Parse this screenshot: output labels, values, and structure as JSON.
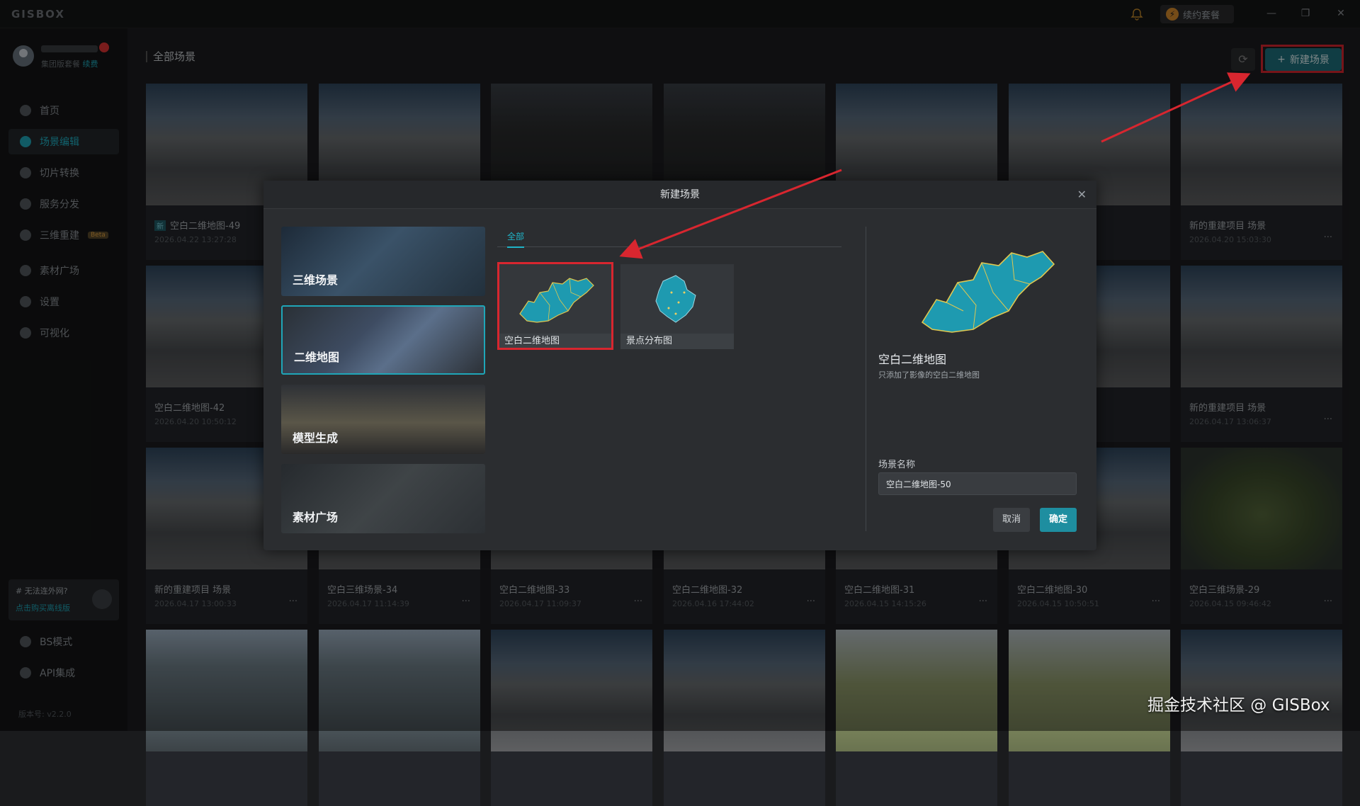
{
  "app": {
    "logo": "GISBOX",
    "renew_label": "续约套餐"
  },
  "user": {
    "tier": "集团版套餐",
    "renew_link": "续费"
  },
  "nav": {
    "items": [
      {
        "label": "首页",
        "active": false
      },
      {
        "label": "场景编辑",
        "active": true
      },
      {
        "label": "切片转换",
        "active": false
      },
      {
        "label": "服务分发",
        "active": false
      },
      {
        "label": "三维重建",
        "active": false,
        "badge": "Beta"
      },
      {
        "label": "素材广场",
        "active": false
      },
      {
        "label": "设置",
        "active": false
      },
      {
        "label": "可视化",
        "active": false
      }
    ],
    "bottom": [
      {
        "label": "BS模式"
      },
      {
        "label": "API集成"
      }
    ]
  },
  "promo": {
    "title": "# 无法连外网?",
    "link": "点击购买离线版"
  },
  "version": "版本号: v2.2.0",
  "header": {
    "breadcrumb": "全部场景",
    "new_scene": "新建场景"
  },
  "cards": [
    {
      "title": "空白二维地图-49",
      "date": "2026.04.22 13:27:28",
      "tag": "新",
      "thumb": "aerial"
    },
    {
      "title": "",
      "date": "",
      "thumb": "aerial"
    },
    {
      "title": "",
      "date": "",
      "thumb": "urban"
    },
    {
      "title": "",
      "date": "",
      "thumb": "urban"
    },
    {
      "title": "",
      "date": "",
      "thumb": "aerial"
    },
    {
      "title": "",
      "date": "",
      "thumb": "aerial"
    },
    {
      "title": "新的重建项目 场景",
      "date": "2026.04.20 15:03:30",
      "thumb": "aerial"
    },
    {
      "title": "空白二维地图-42",
      "date": "2026.04.20 10:50:12",
      "thumb": "aerial"
    },
    {
      "title": "",
      "date": "",
      "thumb": "aerial"
    },
    {
      "title": "",
      "date": "",
      "thumb": "aerial"
    },
    {
      "title": "",
      "date": "",
      "thumb": "aerial"
    },
    {
      "title": "",
      "date": "",
      "thumb": "aerial"
    },
    {
      "title": "",
      "date": "",
      "thumb": "aerial"
    },
    {
      "title": "新的重建项目 场景",
      "date": "2026.04.17 13:06:37",
      "thumb": "aerial"
    },
    {
      "title": "新的重建项目 场景",
      "date": "2026.04.17 13:00:33",
      "thumb": "aerial"
    },
    {
      "title": "空白三维场景-34",
      "date": "2026.04.17 11:14:39",
      "thumb": "aerial"
    },
    {
      "title": "空白二维地图-33",
      "date": "2026.04.17 11:09:37",
      "thumb": "aerial"
    },
    {
      "title": "空白二维地图-32",
      "date": "2026.04.16 17:44:02",
      "thumb": "aerial"
    },
    {
      "title": "空白二维地图-31",
      "date": "2026.04.15 14:15:26",
      "thumb": "aerial"
    },
    {
      "title": "空白二维地图-30",
      "date": "2026.04.15 10:50:51",
      "thumb": "aerial"
    },
    {
      "title": "空白三维场景-29",
      "date": "2026.04.15 09:46:42",
      "thumb": "green"
    },
    {
      "title": "",
      "date": "",
      "thumb": "city"
    },
    {
      "title": "",
      "date": "",
      "thumb": "city"
    },
    {
      "title": "",
      "date": "",
      "thumb": "aerial"
    },
    {
      "title": "",
      "date": "",
      "thumb": "aerial"
    },
    {
      "title": "",
      "date": "",
      "thumb": "factory"
    },
    {
      "title": "",
      "date": "",
      "thumb": "factory"
    },
    {
      "title": "",
      "date": "",
      "thumb": "aerial"
    }
  ],
  "modal": {
    "title": "新建场景",
    "categories": [
      "三维场景",
      "二维地图",
      "模型生成",
      "素材广场"
    ],
    "selected_category": "二维地图",
    "tab": "全部",
    "templates": [
      "空白二维地图",
      "景点分布图"
    ],
    "selected_template": "空白二维地图",
    "preview_title": "空白二维地图",
    "preview_desc": "只添加了影像的空白二维地图",
    "name_label": "场景名称",
    "name_value": "空白二维地图-50",
    "cancel": "取消",
    "ok": "确定"
  },
  "colors": {
    "accent": "#1fa6b8",
    "highlight": "#d8262f",
    "map_fill": "#1e9ab0",
    "map_border": "#e0c850"
  },
  "watermark": "掘金技术社区 @ GISBox"
}
